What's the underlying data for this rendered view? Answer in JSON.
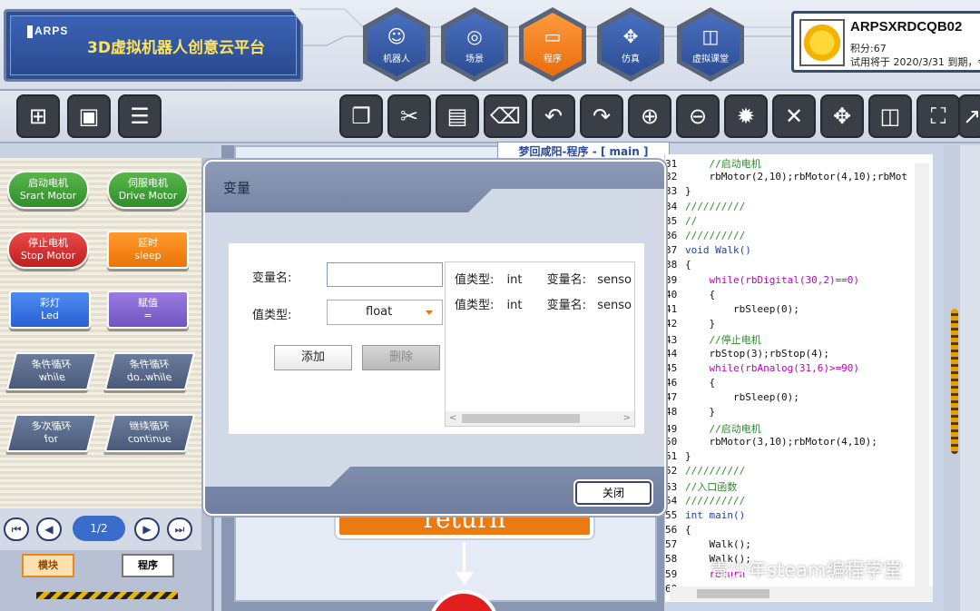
{
  "header": {
    "brand_mark": "ARPS",
    "title": "3D虚拟机器人创意云平台",
    "nav": [
      {
        "label": "机器人",
        "icon": "robot-icon"
      },
      {
        "label": "场景",
        "icon": "globe-icon"
      },
      {
        "label": "程序",
        "icon": "monitor-icon",
        "active": true
      },
      {
        "label": "仿真",
        "icon": "gamepad-icon"
      },
      {
        "label": "虚拟课堂",
        "icon": "classroom-icon"
      }
    ],
    "user": {
      "name": "ARPSXRDCQB02",
      "points": "积分:67",
      "trial": "试用将于 2020/3/31 到期，今"
    }
  },
  "toolbar": {
    "buttons": [
      "new-file",
      "save",
      "stack",
      "copy",
      "cut",
      "paste",
      "delete",
      "undo",
      "redo",
      "zoom-in",
      "zoom-out",
      "settings",
      "close",
      "move",
      "split",
      "fit",
      "curve"
    ]
  },
  "palette": {
    "blocks": [
      {
        "line1": "启动电机",
        "line2": "Srart Motor",
        "style": "green"
      },
      {
        "line1": "伺服电机",
        "line2": "Drive Motor",
        "style": "green"
      },
      {
        "line1": "停止电机",
        "line2": "Stop Motor",
        "style": "red"
      },
      {
        "line1": "延时",
        "line2": "sleep",
        "style": "orange"
      },
      {
        "line1": "彩灯",
        "line2": "Led",
        "style": "blue"
      },
      {
        "line1": "赋值",
        "line2": "=",
        "style": "purple"
      },
      {
        "line1": "条件循环",
        "line2": "while",
        "style": "slate"
      },
      {
        "line1": "条件循环",
        "line2": "do..while",
        "style": "slate"
      },
      {
        "line1": "多次循环",
        "line2": "for",
        "style": "slate"
      },
      {
        "line1": "继续循环",
        "line2": "continue",
        "style": "slate"
      }
    ],
    "page": "1/2",
    "mode_blocks": "模块",
    "mode_program": "程序"
  },
  "canvas": {
    "file_tab": "梦回咸阳-程序 - [ main ]",
    "return_label": "return"
  },
  "code": {
    "lines": [
      {
        "n": "31",
        "t": "    //启动电机",
        "c": "cm"
      },
      {
        "n": "32",
        "t": "    rbMotor(2,10);rbMotor(4,10);rbMot",
        "c": ""
      },
      {
        "n": "33",
        "t": "}",
        "c": ""
      },
      {
        "n": "34",
        "t": "//////////",
        "c": "cm"
      },
      {
        "n": "35",
        "t": "//",
        "c": "cm"
      },
      {
        "n": "36",
        "t": "//////////",
        "c": "cm"
      },
      {
        "n": "37",
        "t": "void Walk()",
        "c": "ty"
      },
      {
        "n": "38",
        "t": "{",
        "c": ""
      },
      {
        "n": "39",
        "t": "    while(rbDigital(30,2)==0)",
        "c": "kw"
      },
      {
        "n": "40",
        "t": "    {",
        "c": ""
      },
      {
        "n": "41",
        "t": "        rbSleep(0);",
        "c": ""
      },
      {
        "n": "42",
        "t": "    }",
        "c": ""
      },
      {
        "n": "43",
        "t": "    //停止电机",
        "c": "cm"
      },
      {
        "n": "44",
        "t": "    rbStop(3);rbStop(4);",
        "c": ""
      },
      {
        "n": "45",
        "t": "    while(rbAnalog(31,6)>=90)",
        "c": "kw"
      },
      {
        "n": "46",
        "t": "    {",
        "c": ""
      },
      {
        "n": "47",
        "t": "        rbSleep(0);",
        "c": ""
      },
      {
        "n": "48",
        "t": "    }",
        "c": ""
      },
      {
        "n": "49",
        "t": "    //启动电机",
        "c": "cm"
      },
      {
        "n": "50",
        "t": "    rbMotor(3,10);rbMotor(4,10);",
        "c": ""
      },
      {
        "n": "51",
        "t": "}",
        "c": ""
      },
      {
        "n": "52",
        "t": "//////////",
        "c": "cm"
      },
      {
        "n": "53",
        "t": "//入口函数",
        "c": "cm"
      },
      {
        "n": "54",
        "t": "//////////",
        "c": "cm"
      },
      {
        "n": "55",
        "t": "int main()",
        "c": "ty"
      },
      {
        "n": "56",
        "t": "{",
        "c": ""
      },
      {
        "n": "57",
        "t": "    Walk();",
        "c": ""
      },
      {
        "n": "58",
        "t": "    Walk();",
        "c": ""
      },
      {
        "n": "59",
        "t": "    return",
        "c": "kw"
      },
      {
        "n": "60",
        "t": "",
        "c": ""
      }
    ]
  },
  "modal": {
    "title": "变量",
    "var_name_label": "变量名:",
    "var_name_value": "",
    "value_type_label": "值类型:",
    "value_type_selected": "float",
    "add_label": "添加",
    "delete_label": "删除",
    "close_label": "关闭",
    "variables": [
      {
        "type_label": "值类型:",
        "type": "int",
        "name_label": "变量名:",
        "name": "senso"
      },
      {
        "type_label": "值类型:",
        "type": "int",
        "name_label": "变量名:",
        "name": "senso"
      }
    ]
  },
  "watermark": "青少年steam编程学堂"
}
